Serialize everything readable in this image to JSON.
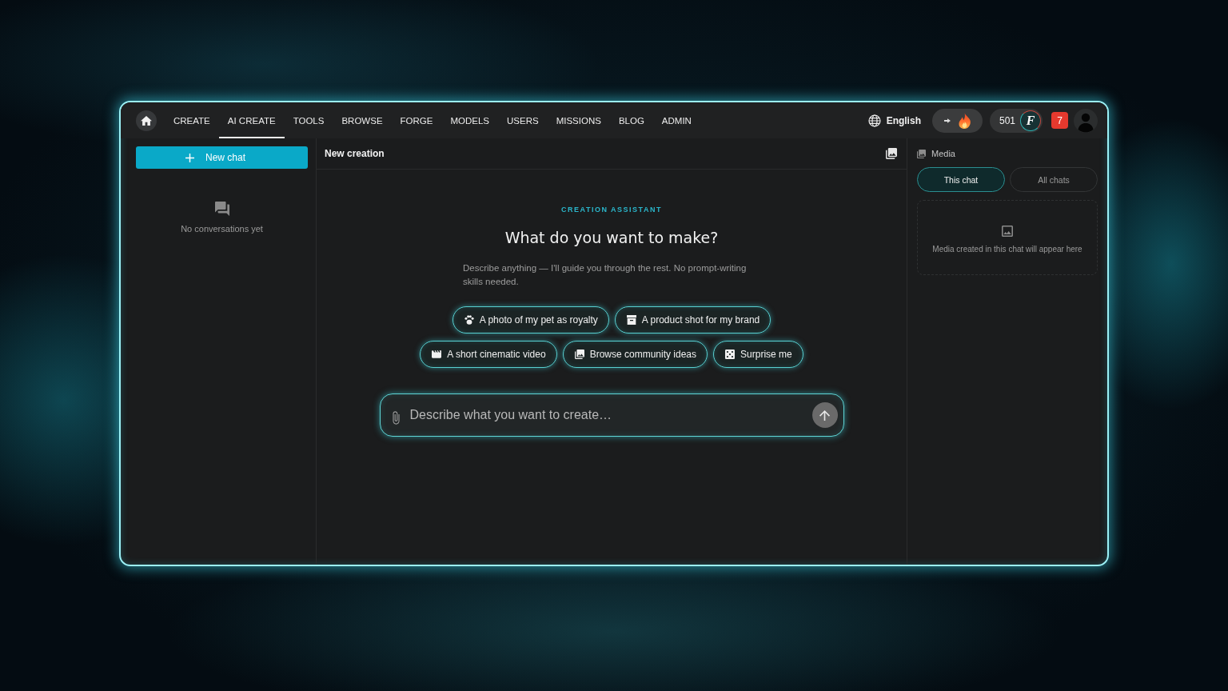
{
  "nav": {
    "items": [
      {
        "label": "CREATE",
        "selected": false
      },
      {
        "label": "AI CREATE",
        "selected": true
      },
      {
        "label": "TOOLS",
        "selected": false
      },
      {
        "label": "BROWSE",
        "selected": false
      },
      {
        "label": "FORGE",
        "selected": false
      },
      {
        "label": "MODELS",
        "selected": false
      },
      {
        "label": "USERS",
        "selected": false
      },
      {
        "label": "MISSIONS",
        "selected": false
      },
      {
        "label": "BLOG",
        "selected": false
      },
      {
        "label": "ADMIN",
        "selected": false
      }
    ],
    "language": "English",
    "credits": {
      "amount": "501",
      "badge_letter": "F"
    },
    "notifications": "7"
  },
  "sidebar": {
    "new_chat_button": "New chat",
    "empty_text": "No conversations yet"
  },
  "main": {
    "title": "New creation",
    "eyebrow": "CREATION ASSISTANT",
    "heading": "What do you want to make?",
    "description": "Describe anything — I'll guide you through the rest. No prompt-writing skills needed.",
    "suggestions": [
      {
        "kind": "pet",
        "label": "A photo of my pet as royalty"
      },
      {
        "kind": "product",
        "label": "A product shot for my brand"
      },
      {
        "kind": "video",
        "label": "A short cinematic video"
      },
      {
        "kind": "community",
        "label": "Browse community ideas"
      },
      {
        "kind": "surprise",
        "label": "Surprise me"
      }
    ],
    "prompt": {
      "placeholder": "Describe what you want to create…"
    }
  },
  "media_panel": {
    "title": "Media",
    "tabs": [
      {
        "label": "This chat",
        "selected": true
      },
      {
        "label": "All chats",
        "selected": false
      }
    ],
    "empty_text": "Media created in this chat will appear here"
  }
}
